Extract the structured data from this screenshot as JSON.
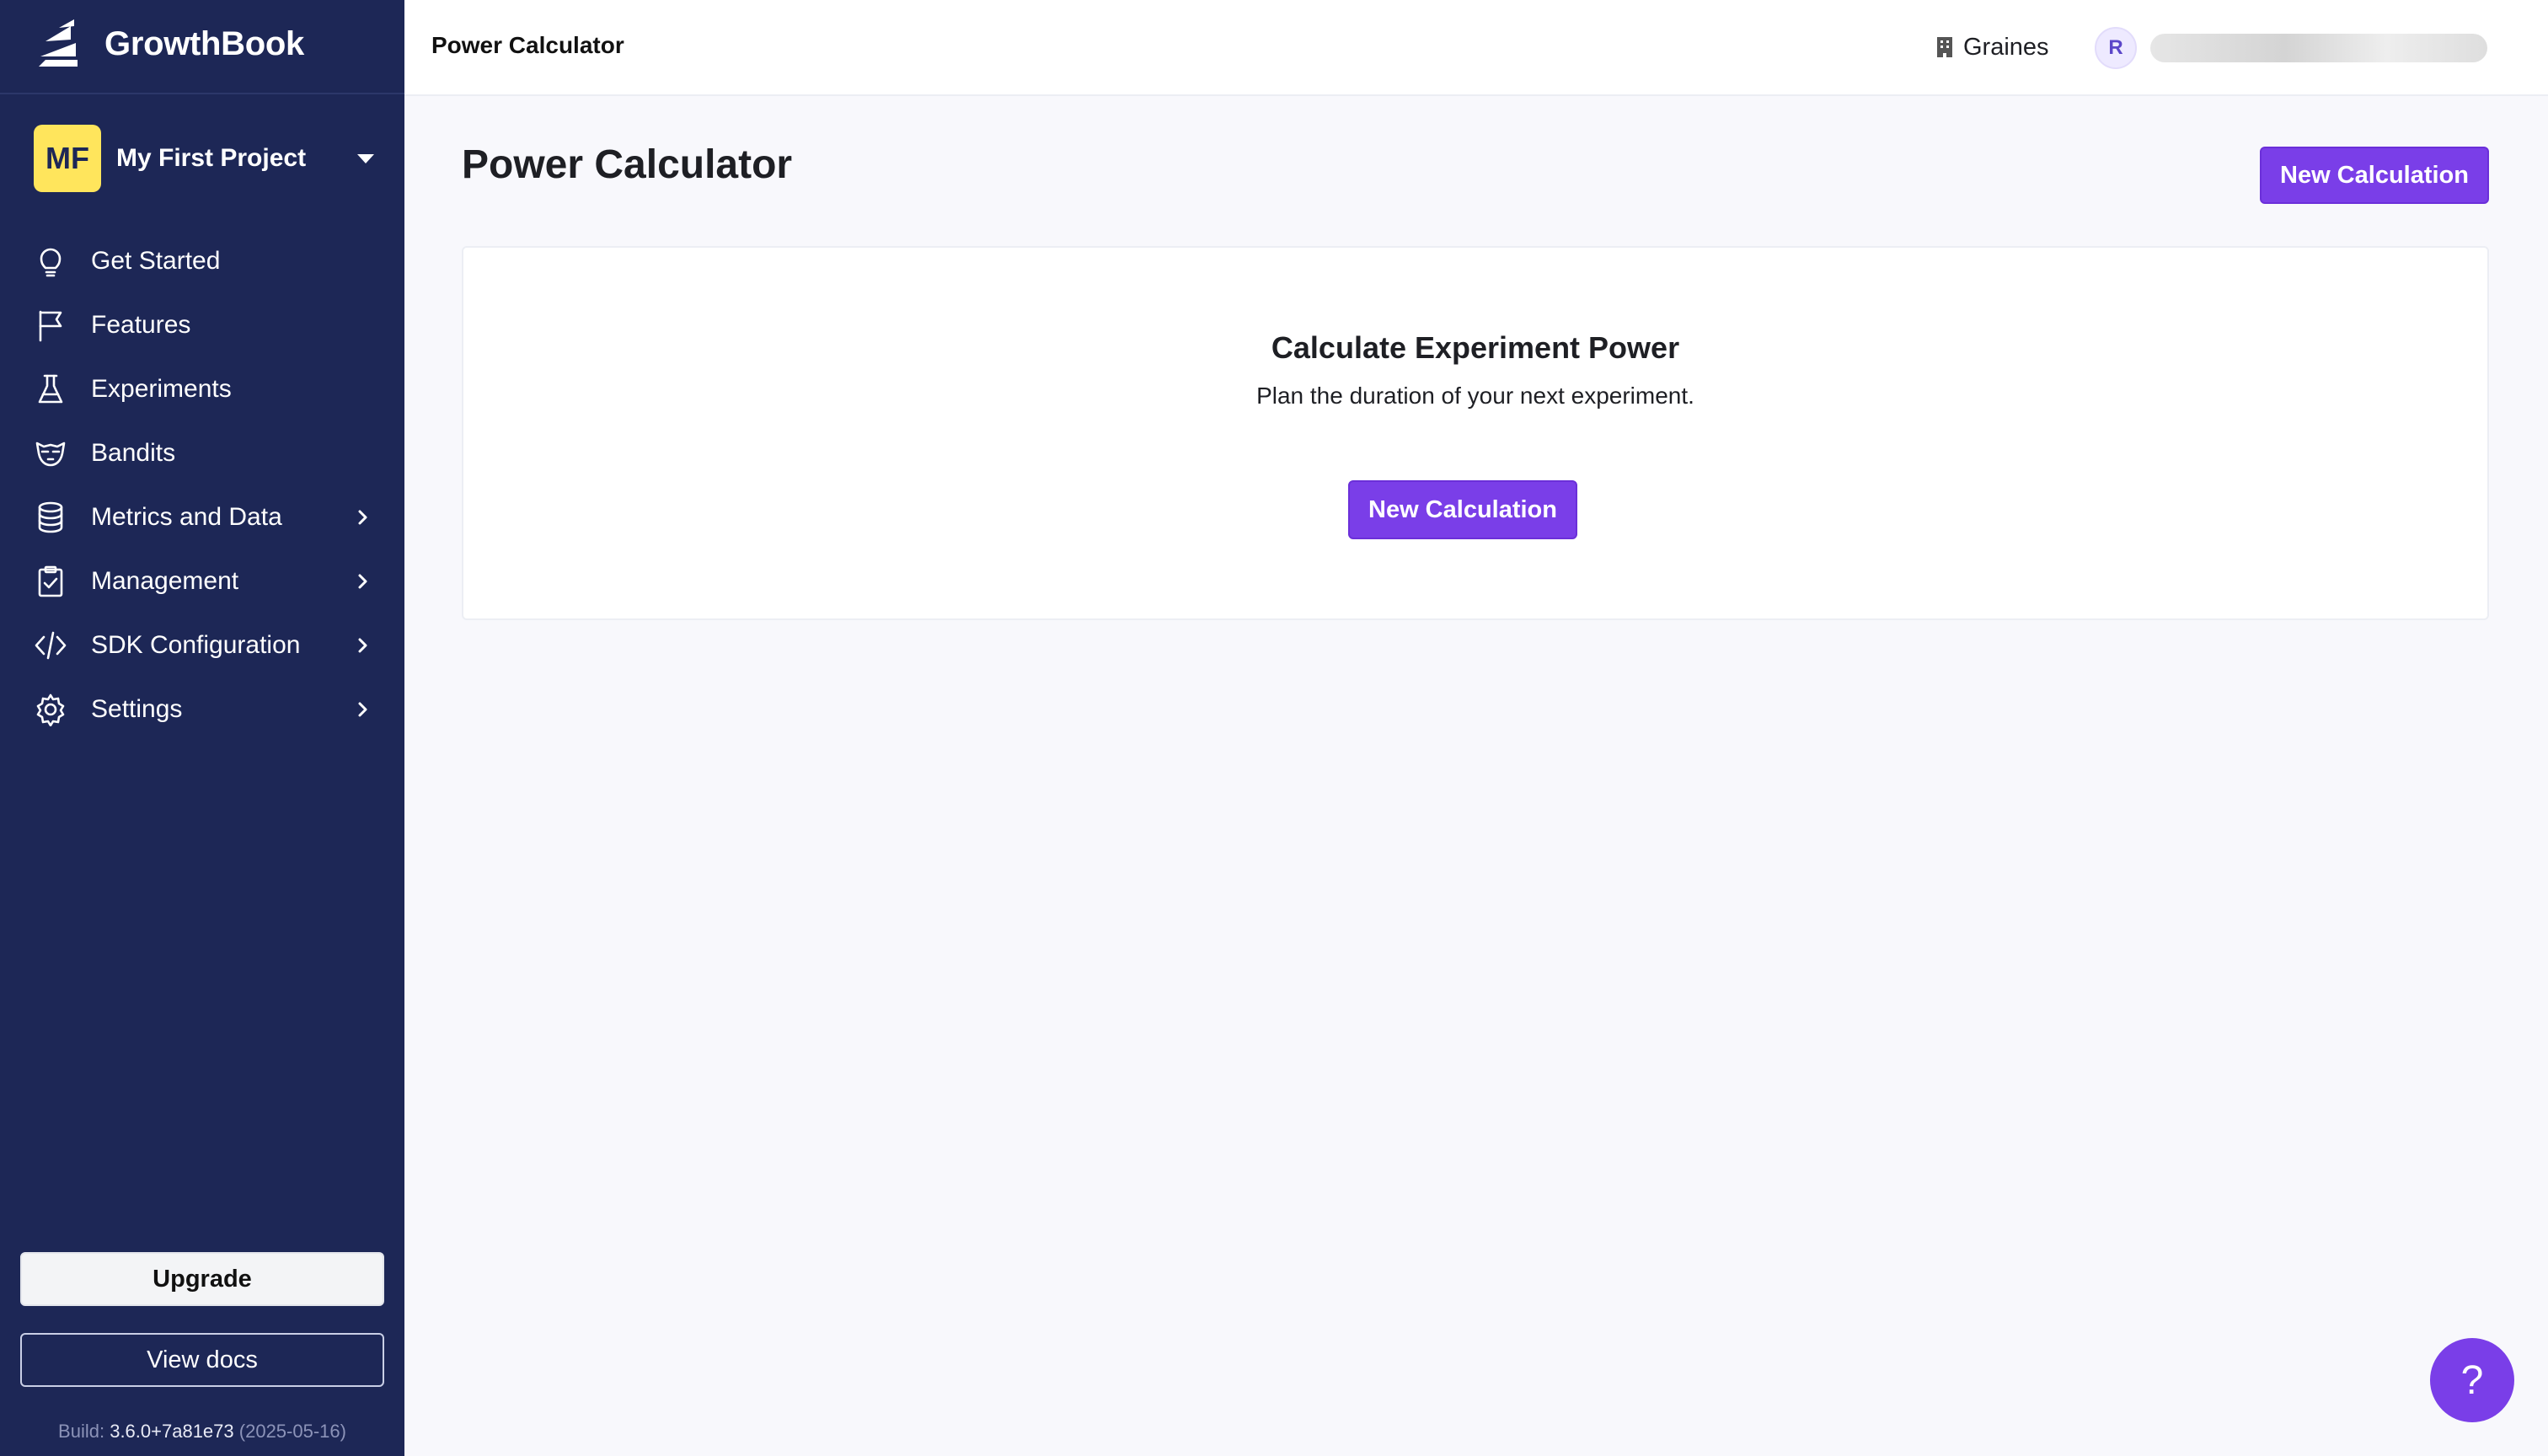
{
  "app": {
    "name": "GrowthBook"
  },
  "project": {
    "initials": "MF",
    "name": "My First Project"
  },
  "sidebar": {
    "items": [
      {
        "label": "Get Started",
        "icon": "lightbulb-icon",
        "has_submenu": false
      },
      {
        "label": "Features",
        "icon": "flag-icon",
        "has_submenu": false
      },
      {
        "label": "Experiments",
        "icon": "beaker-icon",
        "has_submenu": false
      },
      {
        "label": "Bandits",
        "icon": "bandit-icon",
        "has_submenu": false
      },
      {
        "label": "Metrics and Data",
        "icon": "database-icon",
        "has_submenu": true
      },
      {
        "label": "Management",
        "icon": "clipboard-check-icon",
        "has_submenu": true
      },
      {
        "label": "SDK Configuration",
        "icon": "code-icon",
        "has_submenu": true
      },
      {
        "label": "Settings",
        "icon": "gear-icon",
        "has_submenu": true
      }
    ],
    "upgrade_label": "Upgrade",
    "docs_label": "View docs",
    "build": {
      "prefix": "Build:",
      "version": "3.6.0+7a81e73",
      "date": "(2025-05-16)"
    }
  },
  "header": {
    "title": "Power Calculator",
    "org_name": "Graines",
    "user_initial": "R"
  },
  "main": {
    "title": "Power Calculator",
    "new_calc_label": "New Calculation",
    "card": {
      "title": "Calculate Experiment Power",
      "subtitle": "Plan the duration of your next experiment.",
      "button_label": "New Calculation"
    }
  },
  "help": {
    "label": "?"
  },
  "colors": {
    "sidebar_bg": "#1d2756",
    "accent": "#7a3ee8",
    "project_avatar": "#ffe55c"
  }
}
